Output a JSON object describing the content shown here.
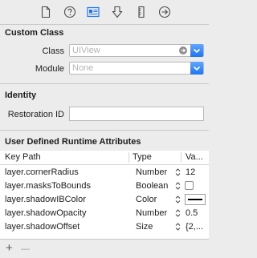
{
  "toolbar": {
    "tabs": [
      {
        "icon": "file-icon",
        "active": false
      },
      {
        "icon": "help-icon",
        "active": false
      },
      {
        "icon": "identity-inspector-icon",
        "active": true
      },
      {
        "icon": "attributes-icon",
        "active": false
      },
      {
        "icon": "size-ruler-icon",
        "active": false
      },
      {
        "icon": "connections-arrow-icon",
        "active": false
      }
    ]
  },
  "custom_class": {
    "title": "Custom Class",
    "class_label": "Class",
    "class_placeholder": "UIView",
    "module_label": "Module",
    "module_placeholder": "None"
  },
  "identity": {
    "title": "Identity",
    "restoration_id_label": "Restoration ID",
    "restoration_id_value": ""
  },
  "runtime_attributes": {
    "title": "User Defined Runtime Attributes",
    "columns": [
      "Key Path",
      "Type",
      "Va..."
    ],
    "rows": [
      {
        "key_path": "layer.cornerRadius",
        "type": "Number",
        "value": "12",
        "control": "text"
      },
      {
        "key_path": "layer.masksToBounds",
        "type": "Boolean",
        "value": "",
        "control": "checkbox"
      },
      {
        "key_path": "layer.shadowIBColor",
        "type": "Color",
        "value": "",
        "control": "color",
        "color": "#000000"
      },
      {
        "key_path": "layer.shadowOpacity",
        "type": "Number",
        "value": "0.5",
        "control": "text"
      },
      {
        "key_path": "layer.shadowOffset",
        "type": "Size",
        "value": "{2,...",
        "control": "text"
      }
    ]
  },
  "footer": {
    "add_label": "+",
    "remove_label": "—"
  },
  "colors": {
    "accent": "#1d74f5",
    "panel_bg": "#ececec",
    "table_bg": "#ffffff"
  }
}
